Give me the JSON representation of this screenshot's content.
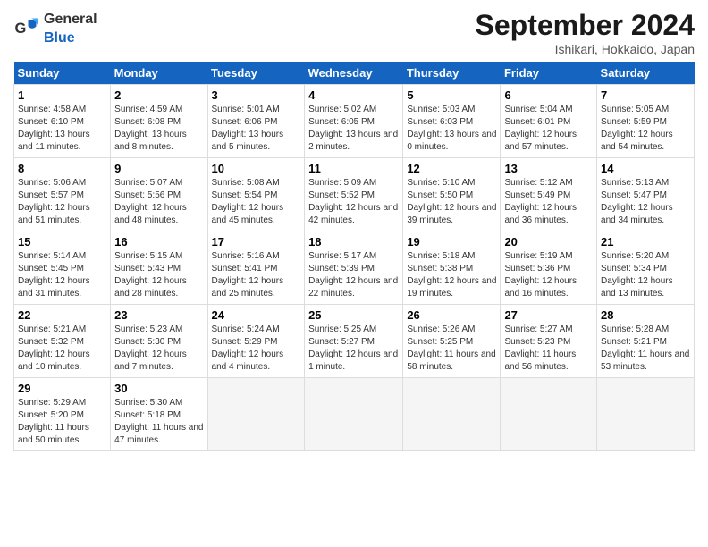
{
  "logo": {
    "general": "General",
    "blue": "Blue"
  },
  "title": "September 2024",
  "location": "Ishikari, Hokkaido, Japan",
  "weekdays": [
    "Sunday",
    "Monday",
    "Tuesday",
    "Wednesday",
    "Thursday",
    "Friday",
    "Saturday"
  ],
  "weeks": [
    [
      {
        "day": "1",
        "sunrise": "4:58 AM",
        "sunset": "6:10 PM",
        "daylight": "13 hours and 11 minutes."
      },
      {
        "day": "2",
        "sunrise": "4:59 AM",
        "sunset": "6:08 PM",
        "daylight": "13 hours and 8 minutes."
      },
      {
        "day": "3",
        "sunrise": "5:01 AM",
        "sunset": "6:06 PM",
        "daylight": "13 hours and 5 minutes."
      },
      {
        "day": "4",
        "sunrise": "5:02 AM",
        "sunset": "6:05 PM",
        "daylight": "13 hours and 2 minutes."
      },
      {
        "day": "5",
        "sunrise": "5:03 AM",
        "sunset": "6:03 PM",
        "daylight": "13 hours and 0 minutes."
      },
      {
        "day": "6",
        "sunrise": "5:04 AM",
        "sunset": "6:01 PM",
        "daylight": "12 hours and 57 minutes."
      },
      {
        "day": "7",
        "sunrise": "5:05 AM",
        "sunset": "5:59 PM",
        "daylight": "12 hours and 54 minutes."
      }
    ],
    [
      {
        "day": "8",
        "sunrise": "5:06 AM",
        "sunset": "5:57 PM",
        "daylight": "12 hours and 51 minutes."
      },
      {
        "day": "9",
        "sunrise": "5:07 AM",
        "sunset": "5:56 PM",
        "daylight": "12 hours and 48 minutes."
      },
      {
        "day": "10",
        "sunrise": "5:08 AM",
        "sunset": "5:54 PM",
        "daylight": "12 hours and 45 minutes."
      },
      {
        "day": "11",
        "sunrise": "5:09 AM",
        "sunset": "5:52 PM",
        "daylight": "12 hours and 42 minutes."
      },
      {
        "day": "12",
        "sunrise": "5:10 AM",
        "sunset": "5:50 PM",
        "daylight": "12 hours and 39 minutes."
      },
      {
        "day": "13",
        "sunrise": "5:12 AM",
        "sunset": "5:49 PM",
        "daylight": "12 hours and 36 minutes."
      },
      {
        "day": "14",
        "sunrise": "5:13 AM",
        "sunset": "5:47 PM",
        "daylight": "12 hours and 34 minutes."
      }
    ],
    [
      {
        "day": "15",
        "sunrise": "5:14 AM",
        "sunset": "5:45 PM",
        "daylight": "12 hours and 31 minutes."
      },
      {
        "day": "16",
        "sunrise": "5:15 AM",
        "sunset": "5:43 PM",
        "daylight": "12 hours and 28 minutes."
      },
      {
        "day": "17",
        "sunrise": "5:16 AM",
        "sunset": "5:41 PM",
        "daylight": "12 hours and 25 minutes."
      },
      {
        "day": "18",
        "sunrise": "5:17 AM",
        "sunset": "5:39 PM",
        "daylight": "12 hours and 22 minutes."
      },
      {
        "day": "19",
        "sunrise": "5:18 AM",
        "sunset": "5:38 PM",
        "daylight": "12 hours and 19 minutes."
      },
      {
        "day": "20",
        "sunrise": "5:19 AM",
        "sunset": "5:36 PM",
        "daylight": "12 hours and 16 minutes."
      },
      {
        "day": "21",
        "sunrise": "5:20 AM",
        "sunset": "5:34 PM",
        "daylight": "12 hours and 13 minutes."
      }
    ],
    [
      {
        "day": "22",
        "sunrise": "5:21 AM",
        "sunset": "5:32 PM",
        "daylight": "12 hours and 10 minutes."
      },
      {
        "day": "23",
        "sunrise": "5:23 AM",
        "sunset": "5:30 PM",
        "daylight": "12 hours and 7 minutes."
      },
      {
        "day": "24",
        "sunrise": "5:24 AM",
        "sunset": "5:29 PM",
        "daylight": "12 hours and 4 minutes."
      },
      {
        "day": "25",
        "sunrise": "5:25 AM",
        "sunset": "5:27 PM",
        "daylight": "12 hours and 1 minute."
      },
      {
        "day": "26",
        "sunrise": "5:26 AM",
        "sunset": "5:25 PM",
        "daylight": "11 hours and 58 minutes."
      },
      {
        "day": "27",
        "sunrise": "5:27 AM",
        "sunset": "5:23 PM",
        "daylight": "11 hours and 56 minutes."
      },
      {
        "day": "28",
        "sunrise": "5:28 AM",
        "sunset": "5:21 PM",
        "daylight": "11 hours and 53 minutes."
      }
    ],
    [
      {
        "day": "29",
        "sunrise": "5:29 AM",
        "sunset": "5:20 PM",
        "daylight": "11 hours and 50 minutes."
      },
      {
        "day": "30",
        "sunrise": "5:30 AM",
        "sunset": "5:18 PM",
        "daylight": "11 hours and 47 minutes."
      },
      null,
      null,
      null,
      null,
      null
    ]
  ]
}
